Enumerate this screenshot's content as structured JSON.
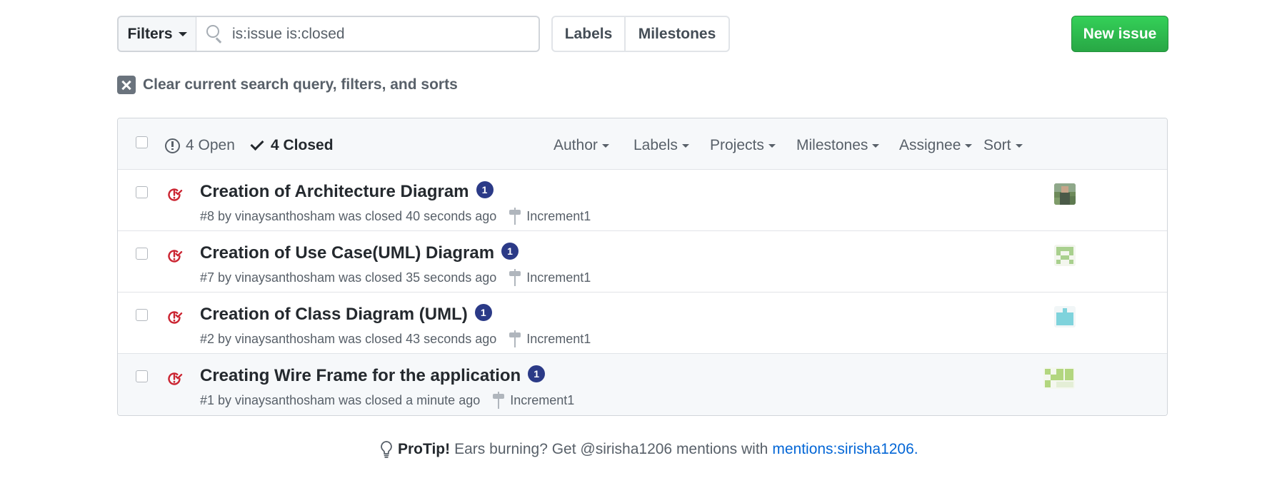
{
  "toolbar": {
    "filters_label": "Filters",
    "search_value": "is:issue is:closed",
    "labels_label": "Labels",
    "milestones_label": "Milestones",
    "new_issue_label": "New issue"
  },
  "clear_query": {
    "text": "Clear current search query, filters, and sorts"
  },
  "header": {
    "open_label": "4 Open",
    "closed_label": "4 Closed",
    "menus": [
      "Author",
      "Labels",
      "Projects",
      "Milestones",
      "Assignee",
      "Sort"
    ]
  },
  "issues": [
    {
      "title": "Creation of Architecture Diagram",
      "comments": "1",
      "meta": "#8 by vinaysanthosham was closed 40 seconds ago",
      "milestone": "Increment1",
      "avatar": "photo"
    },
    {
      "title": "Creation of Use Case(UML) Diagram",
      "comments": "1",
      "meta": "#7 by vinaysanthosham was closed 35 seconds ago",
      "milestone": "Increment1",
      "avatar": "identicon-green"
    },
    {
      "title": "Creation of Class Diagram (UML)",
      "comments": "1",
      "meta": "#2 by vinaysanthosham was closed 43 seconds ago",
      "milestone": "Increment1",
      "avatar": "identicon-cyan"
    },
    {
      "title": "Creating Wire Frame for the application",
      "comments": "1",
      "meta": "#1 by vinaysanthosham was closed a minute ago",
      "milestone": "Increment1",
      "avatar": "identicon-lime"
    }
  ],
  "protip": {
    "strong": "ProTip!",
    "text": "Ears burning? Get @sirisha1206 mentions with",
    "link": "mentions:sirisha1206",
    "suffix": "."
  },
  "colors": {
    "closed_icon": "#cb2431",
    "new_issue_bg": "#2ea44f",
    "comment_badge": "#2b3a87",
    "link": "#0366d6"
  },
  "icons": [
    "search-icon",
    "close-icon",
    "issue-opened-icon",
    "check-icon",
    "issue-closed-icon",
    "milestone-icon",
    "lightbulb-icon"
  ]
}
